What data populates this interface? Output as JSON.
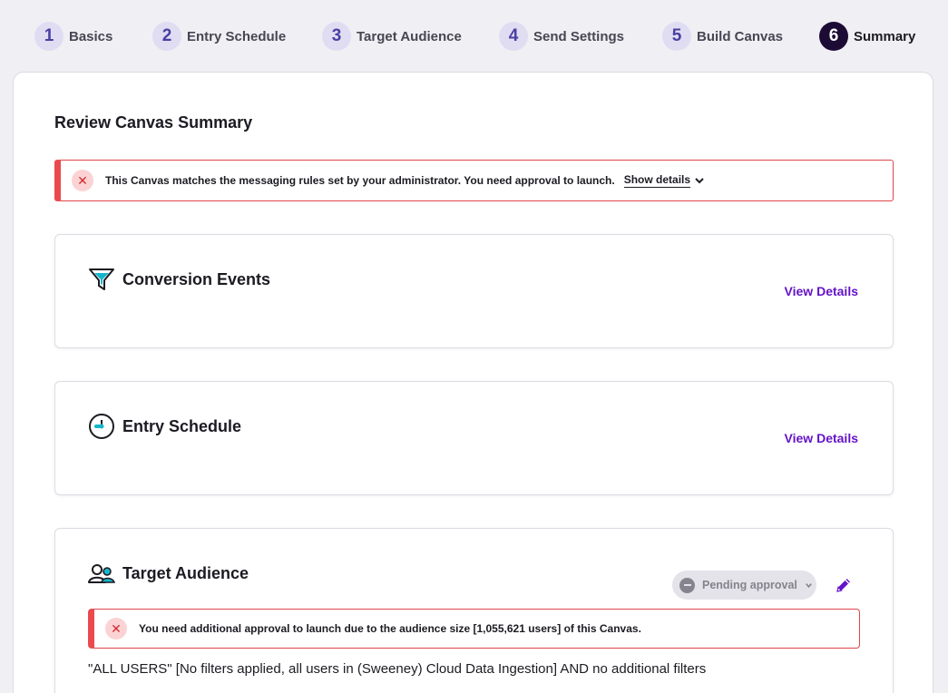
{
  "steps": [
    {
      "num": "1",
      "label": "Basics"
    },
    {
      "num": "2",
      "label": "Entry Schedule"
    },
    {
      "num": "3",
      "label": "Target Audience"
    },
    {
      "num": "4",
      "label": "Send Settings"
    },
    {
      "num": "5",
      "label": "Build Canvas"
    },
    {
      "num": "6",
      "label": "Summary"
    }
  ],
  "active_step": "6",
  "page_title": "Review Canvas Summary",
  "top_alert": {
    "icon": "x-icon",
    "message": "This Canvas matches the messaging rules set by your administrator. You need approval to launch.",
    "link": "Show details"
  },
  "cards": {
    "conversion": {
      "title": "Conversion Events",
      "icon": "funnel-icon",
      "action": "View Details"
    },
    "entry": {
      "title": "Entry Schedule",
      "icon": "clock-icon",
      "action": "View Details"
    },
    "audience": {
      "title": "Target Audience",
      "icon": "users-icon",
      "status": "Pending approval",
      "alert": "You need additional approval to launch due to the audience size [1,055,621 users] of this Canvas.",
      "description": "\"ALL USERS\" [No filters applied, all users in (Sweeney) Cloud Data Ingestion] AND no additional filters"
    }
  },
  "colors": {
    "accent": "#6513c9",
    "error": "#ea4a4e",
    "active_step": "#1b0b35",
    "step_bubble": "#e0ddf3"
  }
}
